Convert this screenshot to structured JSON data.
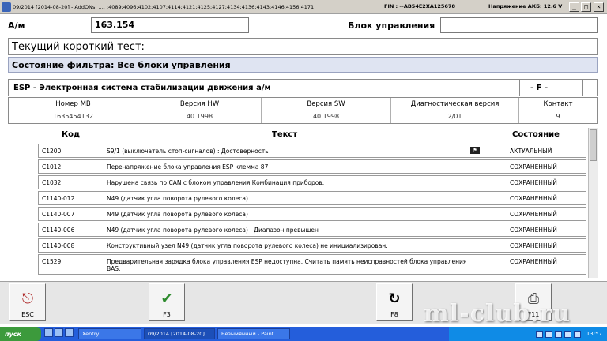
{
  "window": {
    "title": "09/2014 [2014-08-20] - AddONs: .... ;4089;4096;4102;4107;4114;4121;4125;4127;4134;4136;4143;4146;4156;4171",
    "fin": "FIN : --AB54E2XA125678",
    "voltage": "Напряжение АКБ: 12.6 V"
  },
  "header": {
    "am_label": "А/м",
    "am_value": "163.154",
    "control_label": "Блок управления",
    "control_value": "",
    "short_test": "Текущий короткий тест:",
    "filter": "Состояние фильтра: Все блоки управления"
  },
  "esp": {
    "title": "ESP - Электронная система стабилизации движения а/м",
    "flag": "- F -",
    "info": [
      {
        "label": "Номер MB",
        "value": "1635454132"
      },
      {
        "label": "Версия HW",
        "value": "40.1998"
      },
      {
        "label": "Версия SW",
        "value": "40.1998"
      },
      {
        "label": "Диагностическая версия",
        "value": "2/01"
      },
      {
        "label": "Контакт",
        "value": "9"
      }
    ]
  },
  "table": {
    "headers": {
      "code": "Код",
      "text": "Текст",
      "state": "Состояние"
    },
    "rows": [
      {
        "code": "C1200",
        "text": "S9/1 (выключатель стоп-сигналов) : Достоверность",
        "state": "АКТУАЛЬНЫЙ"
      },
      {
        "code": "C1012",
        "text": "Перенапряжение блока управления ESP клемма 87",
        "state": "СОХРАНЕННЫЙ"
      },
      {
        "code": "C1032",
        "text": "Нарушена связь по CAN с блоком управления Комбинация приборов.",
        "state": "СОХРАНЕННЫЙ"
      },
      {
        "code": "C1140-012",
        "text": "N49 (датчик угла поворота рулевого колеса)",
        "state": "СОХРАНЕННЫЙ"
      },
      {
        "code": "C1140-007",
        "text": "N49 (датчик угла поворота рулевого колеса)",
        "state": "СОХРАНЕННЫЙ"
      },
      {
        "code": "C1140-006",
        "text": "N49 (датчик угла поворота рулевого колеса) : Диапазон превышен",
        "state": "СОХРАНЕННЫЙ"
      },
      {
        "code": "C1140-008",
        "text": "Конструктивный узел N49 (датчик угла поворота рулевого колеса) не инициализирован.",
        "state": "СОХРАНЕННЫЙ"
      },
      {
        "code": "C1529",
        "text": "Предварительная зарядка блока управления ESP недоступна. Считать память неисправностей блока управления BAS.",
        "state": "СОХРАНЕННЫЙ"
      }
    ]
  },
  "toolbar": {
    "esc": "ESC",
    "f3": "F3",
    "f8": "F8",
    "f11": "F11"
  },
  "watermark": "ml-club.ru",
  "taskbar": {
    "start": "пуск",
    "tasks": [
      "Xentry",
      "09/2014 [2014-08-20]...",
      "Безымянный - Paint"
    ],
    "clock": "13:57"
  }
}
